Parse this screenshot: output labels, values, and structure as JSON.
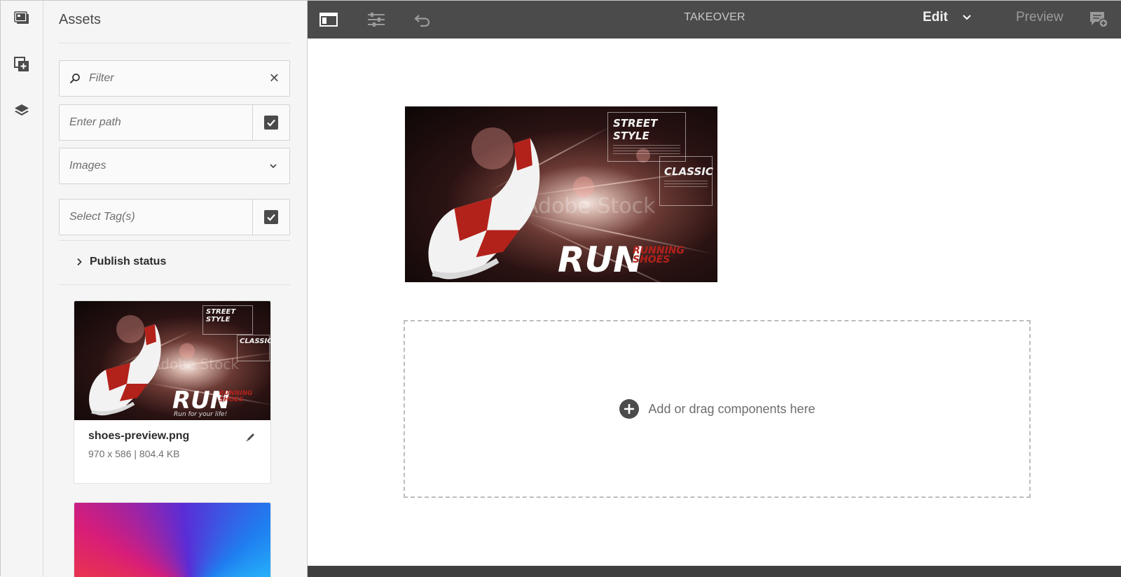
{
  "panel": {
    "title": "Assets",
    "filter_placeholder": "Filter",
    "path_placeholder": "Enter path",
    "type_select_value": "Images",
    "tags_placeholder": "Select Tag(s)",
    "publish_status_label": "Publish status"
  },
  "assets": [
    {
      "filename": "shoes-preview.png",
      "details": "970 x 586 | 804.4 KB"
    }
  ],
  "topbar": {
    "title": "TAKEOVER",
    "mode_label": "Edit",
    "preview_label": "Preview"
  },
  "artwork": {
    "street_style": "STREET STYLE",
    "classic": "CLASSIC",
    "run": "RUN",
    "running_shoes_1": "RUNNING",
    "running_shoes_2": "SHOES",
    "tagline": "Run for your life!",
    "watermark": "Adobe Stock"
  },
  "canvas": {
    "dropzone_label": "Add or drag components here"
  },
  "icons": {
    "rail": [
      "assets-icon",
      "components-icon",
      "layers-icon"
    ],
    "topbar": [
      "side-panel-icon",
      "properties-icon",
      "undo-icon",
      "annotations-icon"
    ]
  }
}
